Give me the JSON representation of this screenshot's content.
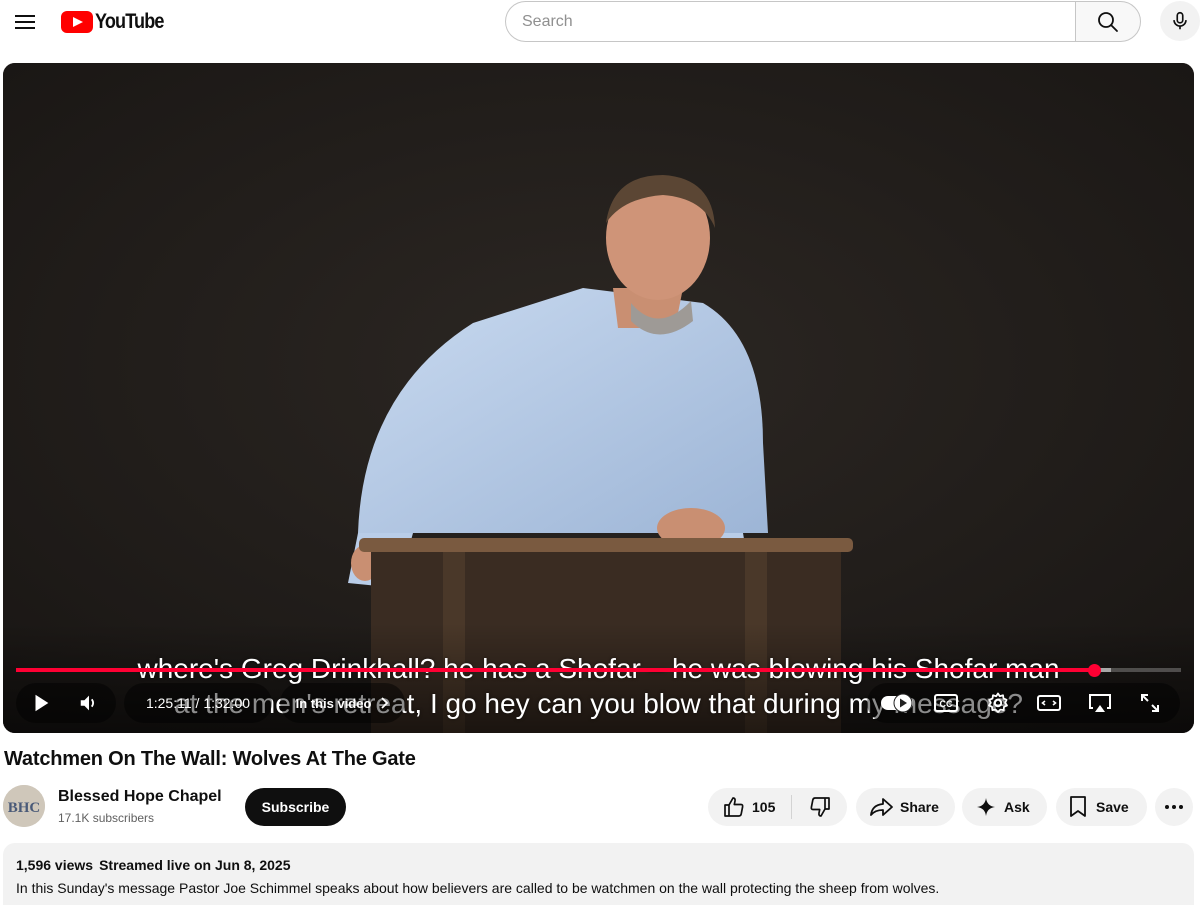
{
  "header": {
    "logo_text": "YouTube",
    "search_placeholder": "Search"
  },
  "player": {
    "captions": [
      "where's Greg Drinkhall? he has a Shofar – he was blowing his Shofar man",
      "at the men's retreat, I go hey can you blow that during my message?"
    ],
    "progress_fraction": 0.9257,
    "buffered_fraction": 0.94,
    "time_current": "1:25:11",
    "time_separator": " / ",
    "time_total": "1:32:00",
    "chapters_label": "In this video",
    "accent_color": "#ff0033"
  },
  "video": {
    "title": "Watchmen On The Wall: Wolves At The Gate"
  },
  "owner": {
    "avatar_text": "BHC",
    "channel_name": "Blessed Hope Chapel",
    "subscribers": "17.1K subscribers",
    "subscribe_label": "Subscribe"
  },
  "actions": {
    "like_count": "105",
    "share_label": "Share",
    "ask_label": "Ask",
    "save_label": "Save"
  },
  "description": {
    "views": "1,596 views",
    "date": "Streamed live on Jun 8, 2025",
    "text": "In this Sunday's message Pastor Joe Schimmel speaks about how believers are called to be watchmen on the wall protecting the sheep from wolves."
  }
}
